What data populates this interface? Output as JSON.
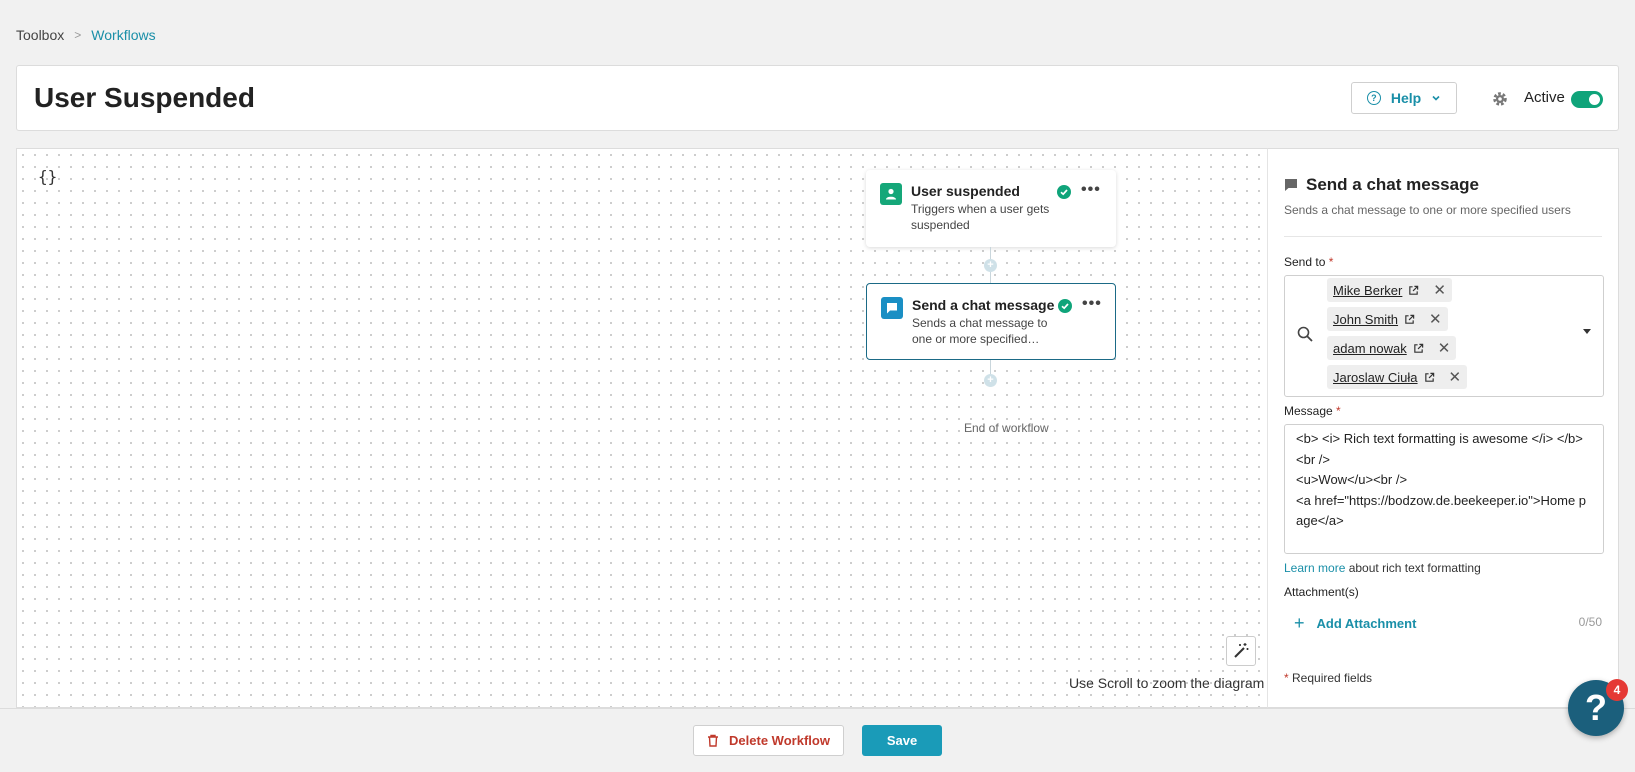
{
  "breadcrumb": {
    "root": "Toolbox",
    "separator": ">",
    "current": "Workflows"
  },
  "header": {
    "title": "User Suspended",
    "help_label": "Help",
    "active_label": "Active",
    "active": true
  },
  "canvas": {
    "variables_glyph": "{}",
    "nodes": [
      {
        "title": "User suspended",
        "description": "Triggers when a user gets suspended",
        "icon": "user-icon",
        "color": "#15a779"
      },
      {
        "title": "Send a chat message",
        "description": "Sends a chat message to one or more specified…",
        "icon": "chat-icon",
        "color": "#1a8fc4"
      }
    ],
    "end_label": "End of workflow",
    "zoom_hint": "Use Scroll to zoom the diagram"
  },
  "panel": {
    "title": "Send a chat message",
    "subtitle": "Sends a chat message to one or more specified users",
    "send_to_label": "Send to",
    "required_mark": "*",
    "recipients": [
      "Mike Berker",
      "John Smith",
      "adam nowak",
      "Jaroslaw Ciuła"
    ],
    "message_label": "Message",
    "message_value": "<b> <i> Rich text formatting is awesome </i> </b> <br />\n<u>Wow</u><br />\n<a href=\"https://bodzow.de.beekeeper.io\">Home page</a>",
    "learn_more_link": "Learn more",
    "learn_more_text": " about rich text formatting",
    "attachments_label": "Attachment(s)",
    "add_attachment_label": "Add Attachment",
    "attachment_count": "0/50",
    "required_note": " Required fields"
  },
  "footer": {
    "delete_label": "Delete Workflow",
    "save_label": "Save"
  },
  "help_fab": {
    "glyph": "?",
    "badge": "4"
  },
  "colors": {
    "accent": "#1a9bb8",
    "success": "#0fa47a",
    "danger": "#c0392b"
  }
}
